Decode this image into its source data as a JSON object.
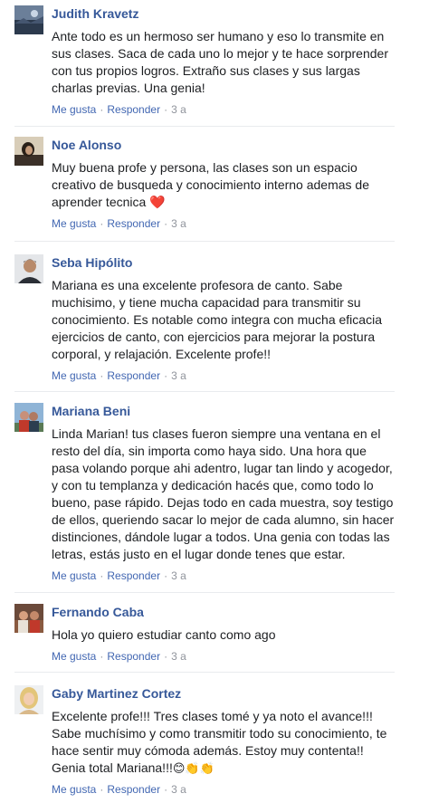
{
  "comments": [
    {
      "author": "Judith Kravetz",
      "text": "Ante todo es un hermoso ser humano y eso lo transmite en\nsus clases. Saca de cada uno lo mejor y te hace sorprender\ncon tus propios logros. Extraño sus clases y sus largas\ncharlas previas. Una genia!",
      "like": "Me gusta",
      "reply": "Responder",
      "time": "3 a",
      "separator": "·"
    },
    {
      "author": "Noe Alonso",
      "text": "Muy buena profe y persona, las clases son un espacio\ncreativo de busqueda y conocimiento interno ademas de\naprender tecnica ",
      "emoji": "❤️",
      "like": "Me gusta",
      "reply": "Responder",
      "time": "3 a",
      "separator": "·"
    },
    {
      "author": "Seba Hipólito",
      "text": "Mariana es una excelente profesora de canto. Sabe\nmuchisimo, y tiene mucha capacidad para transmitir su\nconocimiento. Es notable como integra con mucha eficacia\nejercicios de canto, con ejercicios para mejorar la postura\ncorporal, y relajación. Excelente profe!!",
      "like": "Me gusta",
      "reply": "Responder",
      "time": "3 a",
      "separator": "·"
    },
    {
      "author": "Mariana Beni",
      "text": "Linda Marian! tus clases fueron siempre una ventana en el\nresto del día, sin importa como haya sido. Una hora que\npasa volando porque ahi adentro, lugar tan lindo y acogedor,\ny con tu templanza y dedicación hacés que, como todo lo\nbueno, pase rápido. Dejas todo en cada muestra, soy testigo\nde ellos, queriendo sacar lo mejor de cada alumno, sin hacer\ndistinciones, dándole lugar a todos. Una genia con todas las\nletras, estás justo en el lugar donde tenes que estar.",
      "like": "Me gusta",
      "reply": "Responder",
      "time": "3 a",
      "separator": "·"
    },
    {
      "author": "Fernando Caba",
      "text": "Hola yo quiero estudiar canto como ago",
      "like": "Me gusta",
      "reply": "Responder",
      "time": "3 a",
      "separator": "·"
    },
    {
      "author": "Gaby Martinez Cortez",
      "text": "Excelente profe!!! Tres clases tomé y ya noto el avance!!!\nSabe muchísimo y como transmitir todo su conocimiento, te\nhace sentir muy cómoda además. Estoy muy contenta!!\nGenia total Mariana!!!",
      "emoji": "😊👏👏",
      "like": "Me gusta",
      "reply": "Responder",
      "time": "3 a",
      "separator": "·"
    }
  ],
  "colors": {
    "author": "#365899",
    "link": "#4267b2",
    "meta": "#90949c",
    "text": "#1c1e21",
    "divider": "#e9ebee"
  },
  "icons": {
    "avatar": "profile-photo"
  }
}
